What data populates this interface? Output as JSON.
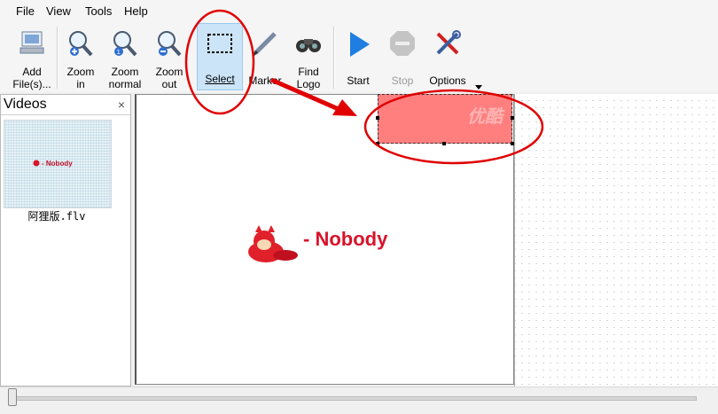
{
  "menu": {
    "file": "File",
    "view": "View",
    "tools": "Tools",
    "help": "Help"
  },
  "toolbar": {
    "add_files": [
      "Add",
      "File(s)..."
    ],
    "zoom_in": [
      "Zoom",
      "in"
    ],
    "zoom_normal": [
      "Zoom",
      "normal"
    ],
    "zoom_out": [
      "Zoom",
      "out"
    ],
    "select": "Select",
    "marker": "Marker",
    "find_logo": [
      "Find",
      "Logo"
    ],
    "start": "Start",
    "stop": "Stop",
    "options": "Options"
  },
  "videos": {
    "title": "Videos",
    "close": "×",
    "item_name": "阿狸版.flv",
    "thumb_text": "- Nobody"
  },
  "preview": {
    "logo_text": "- Nobody",
    "selection_glyph": "优酷"
  },
  "colors": {
    "selection_fill": "#ff7f7f",
    "annotation_red": "#e00000",
    "select_highlight": "#cce4f7"
  }
}
